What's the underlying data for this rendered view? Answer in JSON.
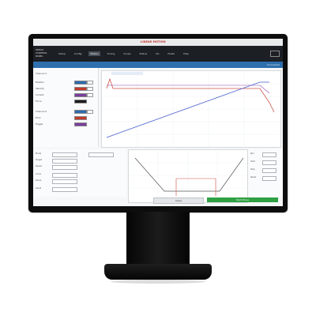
{
  "menubar": {
    "items": [
      "File",
      "Edit",
      "View",
      "Tools",
      "Help"
    ],
    "brand": "LINEAR MOTION"
  },
  "nav": {
    "logo_lines": [
      "SERVO",
      "CONTROL",
      "PANEL"
    ],
    "items": [
      "Setup",
      "Config",
      "Motion",
      "Tuning",
      "Scope",
      "Status",
      "I/O",
      "Faults",
      "Help"
    ],
    "active_index": 2
  },
  "titlebar": {
    "title": "Axis 1 - Move Profile - Scope View",
    "right": "Connected"
  },
  "left_panel": {
    "rows": [
      "Channel 1",
      "Position",
      "Velocity",
      "Current",
      "Force",
      "Channel 2",
      "Error",
      "Trigger"
    ],
    "swatch_colors": [
      "#2b6cb0",
      "#c0392b",
      "#7a3e9d",
      "#1d1d1d",
      "#2b6cb0",
      "#c0392b",
      "#7a3e9d",
      "#1d1d1d"
    ]
  },
  "mid_left": {
    "labels": [
      "Mode",
      "Target",
      "Speed",
      "Accel",
      "Decel",
      "Dwell"
    ]
  },
  "right_panel": {
    "labels": [
      "Run",
      "Hold",
      "Stop",
      "Reset"
    ]
  },
  "buttons": {
    "secondary": "Apply",
    "primary": "Start Move"
  },
  "colors": {
    "nav": "#1c1f24",
    "titlebar": "#2f6fae",
    "primary_button": "#2fa043",
    "trace_red": "#d0504a",
    "trace_blue": "#4a5fd0",
    "trace_purple": "#8e44ad"
  }
}
